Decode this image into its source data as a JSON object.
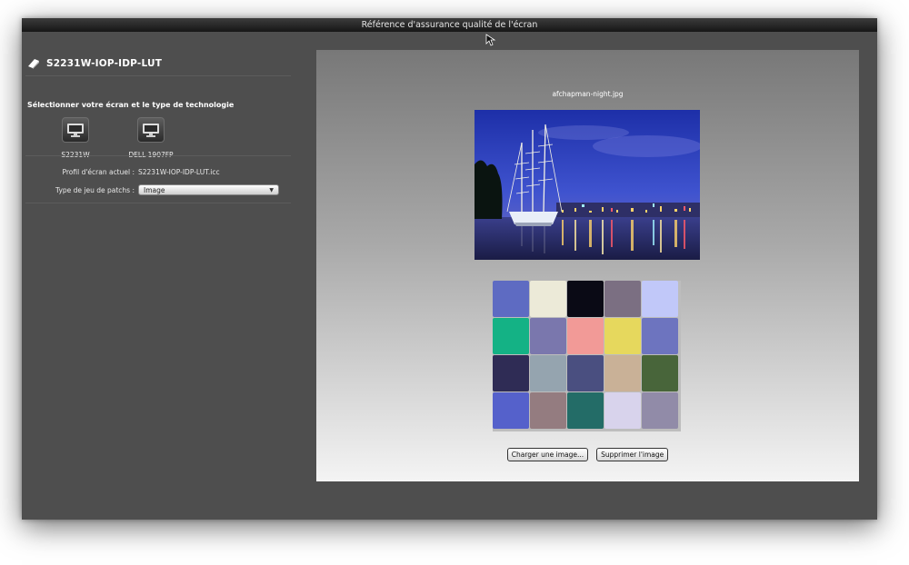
{
  "window": {
    "title": "Référence d'assurance qualité de l'écran"
  },
  "sidebar": {
    "device_title": "S2231W-IOP-IDP-LUT",
    "section_heading": "Sélectionner votre écran et le type de technologie",
    "monitors": [
      {
        "label": "S2231W",
        "icon": "monitor-icon"
      },
      {
        "label": "DELL 1907FP",
        "icon": "monitor-icon"
      }
    ],
    "profile_label": "Profil d'écran actuel :",
    "profile_value": "S2231W-IOP-IDP-LUT.icc",
    "patch_type_label": "Type de jeu de patchs :",
    "patch_type_value": "Image"
  },
  "main": {
    "filename": "afchapman-night.jpg",
    "patches": [
      "#5e6bc2",
      "#ecead8",
      "#0a0a15",
      "#7b6f82",
      "#c1c8f9",
      "#14b285",
      "#7a77ad",
      "#f29a97",
      "#e6d85d",
      "#6d74bf",
      "#2f2c55",
      "#95a4af",
      "#4a4f80",
      "#c9b197",
      "#48653a",
      "#5561cb",
      "#947c80",
      "#236c67",
      "#d8d3ec",
      "#918ba8"
    ],
    "load_button": "Charger une image...",
    "delete_button": "Supprimer l'image"
  }
}
